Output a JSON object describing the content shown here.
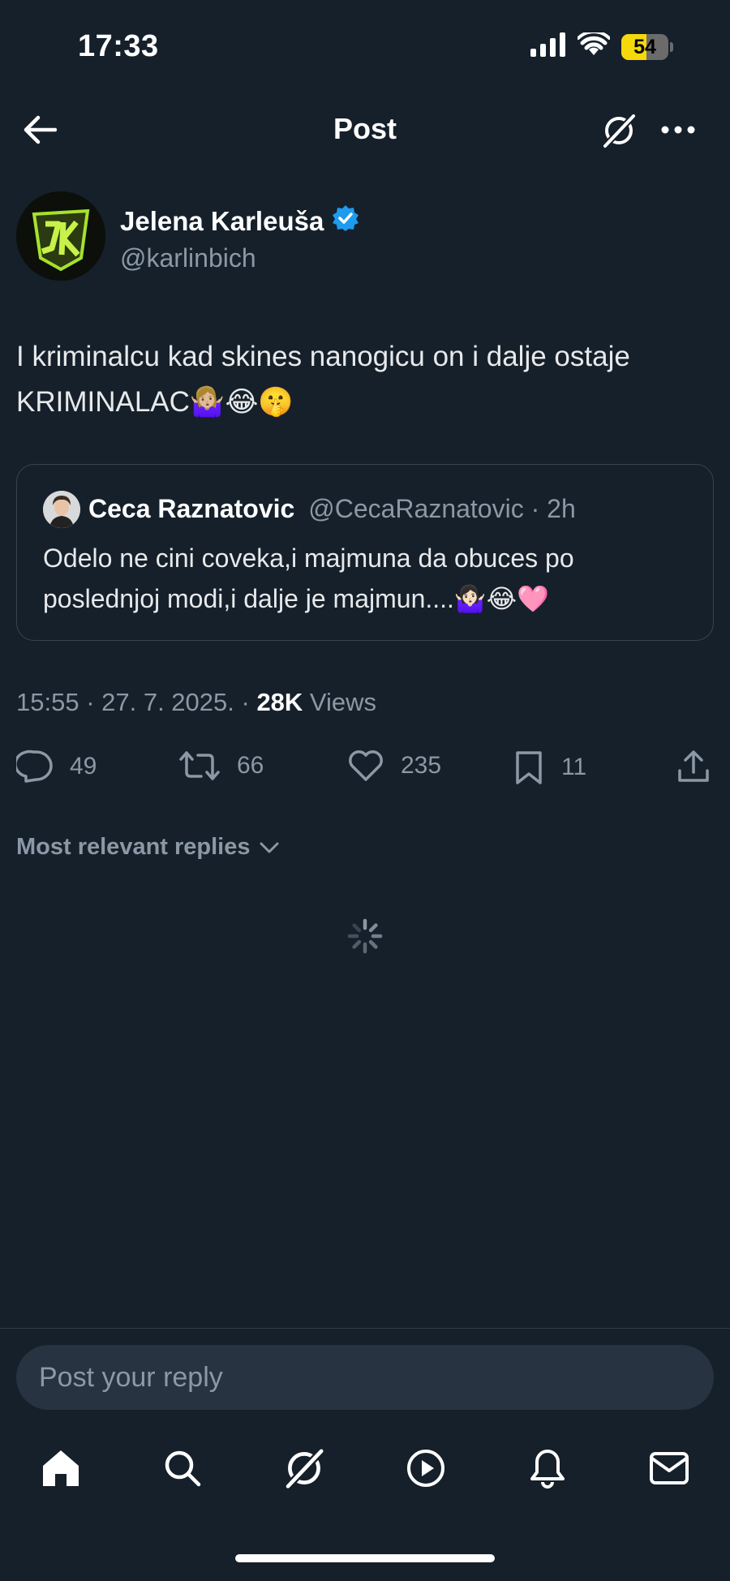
{
  "status_bar": {
    "time": "17:33",
    "battery": "54",
    "battery_level": 0.54
  },
  "header": {
    "title": "Post",
    "back_icon": "arrow-left-icon",
    "grok_icon": "grok-icon",
    "more_icon": "more-horizontal-icon"
  },
  "post": {
    "author_name": "Jelena Karleuša",
    "author_handle": "@karlinbich",
    "verified": true,
    "text": "I kriminalcu kad skines nanogicu on i dalje ostaje KRIMINALAC🤷🏼‍♀️😂🤫",
    "timestamp": "15:55 · 27. 7. 2025. · ",
    "views_count": "28K",
    "views_label": " Views"
  },
  "quote": {
    "name": "Ceca Raznatovic",
    "handle": "@CecaRaznatovic",
    "separator": " · ",
    "time": "2h",
    "text": "Odelo ne cini coveka,i majmuna da obuces po poslednjoj modi,i dalje je majmun....🤷🏻‍♀️😂🩷"
  },
  "actions": {
    "replies": "49",
    "reposts": "66",
    "likes": "235",
    "bookmarks": "11"
  },
  "replies": {
    "filter_label": "Most relevant replies"
  },
  "reply_box": {
    "placeholder": "Post your reply"
  },
  "tabbar": {
    "items": [
      "home-icon",
      "search-icon",
      "grok-icon",
      "video-icon",
      "notifications-icon",
      "messages-icon"
    ]
  },
  "colors": {
    "background": "#15202b",
    "accent_blue": "#1d9bf0",
    "secondary_text": "#8b98a5",
    "battery_yellow": "#f5d90a"
  }
}
